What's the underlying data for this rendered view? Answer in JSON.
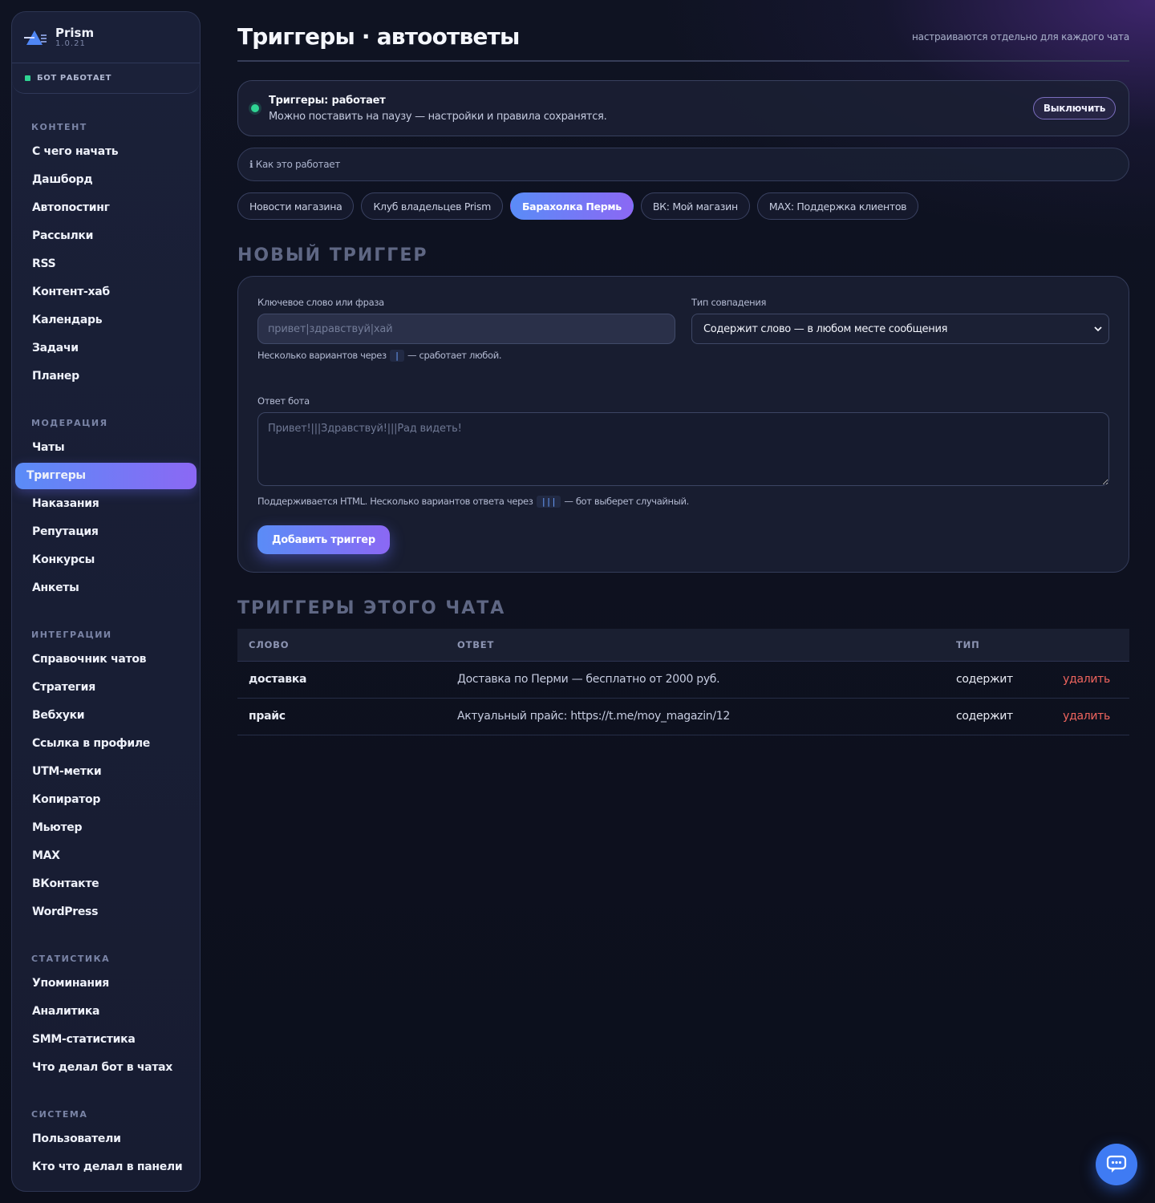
{
  "brand": {
    "name": "Prism",
    "version": "1.0.21"
  },
  "bot_status": "БОТ РАБОТАЕТ",
  "colors": {
    "accent_start": "#5a8cf7",
    "accent_end": "#8b68f4",
    "ok": "#2fd493",
    "danger": "#f0655e"
  },
  "sidebar": {
    "sections": [
      {
        "title": "КОНТЕНТ",
        "items": [
          "С чего начать",
          "Дашборд",
          "Автопостинг",
          "Рассылки",
          "RSS",
          "Контент-хаб",
          "Календарь",
          "Задачи",
          "Планер"
        ]
      },
      {
        "title": "МОДЕРАЦИЯ",
        "items": [
          "Чаты",
          "Триггеры",
          "Наказания",
          "Репутация",
          "Конкурсы",
          "Анкеты"
        ]
      },
      {
        "title": "ИНТЕГРАЦИИ",
        "items": [
          "Справочник чатов",
          "Стратегия",
          "Вебхуки",
          "Ссылка в профиле",
          "UTM-метки",
          "Копиратор",
          "Мьютер",
          "MAX",
          "ВКонтакте",
          "WordPress"
        ]
      },
      {
        "title": "СТАТИСТИКА",
        "items": [
          "Упоминания",
          "Аналитика",
          "SMM-статистика",
          "Что делал бот в чатах"
        ]
      },
      {
        "title": "СИСТЕМА",
        "items": [
          "Пользователи",
          "Кто что делал в панели"
        ]
      }
    ],
    "active_item": "Триггеры"
  },
  "header": {
    "title": "Триггеры · автоответы",
    "hint": "настраиваются отдельно для каждого чата"
  },
  "status": {
    "title": "Триггеры: работает",
    "subtitle": "Можно поставить на паузу — настройки и правила сохранятся.",
    "button": "Выключить"
  },
  "howto": "ℹ Как это работает",
  "chats": {
    "tabs": [
      "Новости магазина",
      "Клуб владельцев Prism",
      "Барахолка Пермь",
      "ВК: Мой магазин",
      "MAX: Поддержка клиентов"
    ],
    "active": "Барахолка Пермь"
  },
  "new_trigger": {
    "section_title": "НОВЫЙ ТРИГГЕР",
    "keyword_label": "Ключевое слово или фраза",
    "keyword_placeholder": "привет|здравствуй|хай",
    "keyword_help_pre": "Несколько вариантов через",
    "keyword_help_code": "|",
    "keyword_help_post": "— сработает любой.",
    "match_label": "Тип совпадения",
    "match_value": "Содержит слово — в любом месте сообщения",
    "reply_label": "Ответ бота",
    "reply_placeholder": "Привет!|||Здравствуй!|||Рад видеть!",
    "reply_help_pre": "Поддерживается HTML. Несколько вариантов ответа через",
    "reply_help_code": "|||",
    "reply_help_post": "— бот выберет случайный.",
    "add_button": "Добавить триггер"
  },
  "triggers_list": {
    "section_title": "ТРИГГЕРЫ ЭТОГО ЧАТА",
    "columns": [
      "СЛОВО",
      "ОТВЕТ",
      "ТИП"
    ],
    "rows": [
      {
        "word": "доставка",
        "answer": "Доставка по Перми — бесплатно от 2000 руб.",
        "type": "содержит",
        "action": "удалить"
      },
      {
        "word": "прайс",
        "answer": "Актуальный прайс: https://t.me/moy_magazin/12",
        "type": "содержит",
        "action": "удалить"
      }
    ]
  },
  "fab_icon": "chat-bubble-icon"
}
